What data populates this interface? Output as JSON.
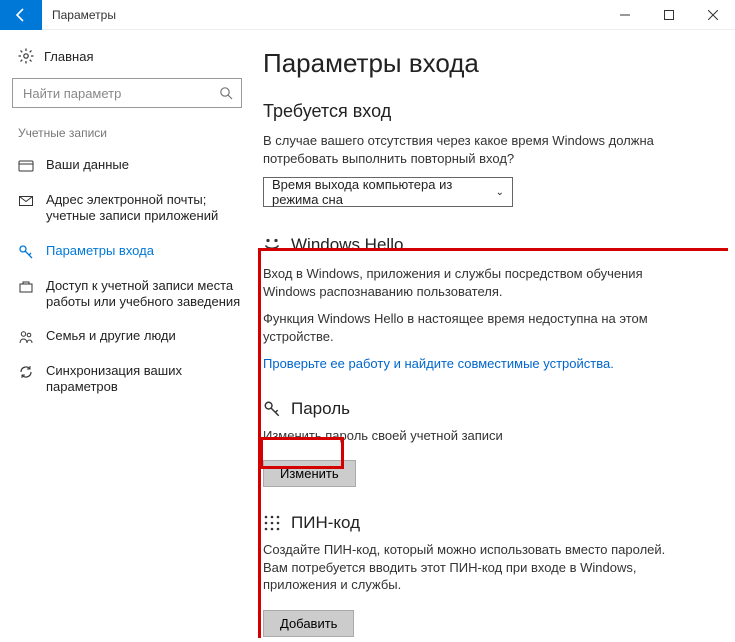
{
  "titlebar": {
    "title": "Параметры"
  },
  "sidebar": {
    "home": "Главная",
    "search_placeholder": "Найти параметр",
    "section": "Учетные записи",
    "items": [
      {
        "label": "Ваши данные"
      },
      {
        "label": "Адрес электронной почты; учетные записи приложений"
      },
      {
        "label": "Параметры входа"
      },
      {
        "label": "Доступ к учетной записи места работы или учебного заведения"
      },
      {
        "label": "Семья и другие люди"
      },
      {
        "label": "Синхронизация ваших параметров"
      }
    ]
  },
  "main": {
    "title": "Параметры входа",
    "require_signin": {
      "heading": "Требуется вход",
      "desc": "В случае вашего отсутствия через какое время Windows должна потребовать выполнить повторный вход?",
      "dropdown_value": "Время выхода компьютера из режима сна"
    },
    "hello": {
      "heading": "Windows Hello",
      "desc1": "Вход в Windows, приложения и службы посредством обучения Windows распознаванию пользователя.",
      "desc2": "Функция Windows Hello в настоящее время недоступна на этом устройстве.",
      "link": "Проверьте ее работу и найдите совместимые устройства."
    },
    "password": {
      "heading": "Пароль",
      "desc": "Изменить пароль своей учетной записи",
      "button": "Изменить"
    },
    "pin": {
      "heading": "ПИН-код",
      "desc": "Создайте ПИН-код, который можно использовать вместо паролей. Вам потребуется вводить этот ПИН-код при входе в Windows, приложения и службы.",
      "button": "Добавить"
    }
  }
}
